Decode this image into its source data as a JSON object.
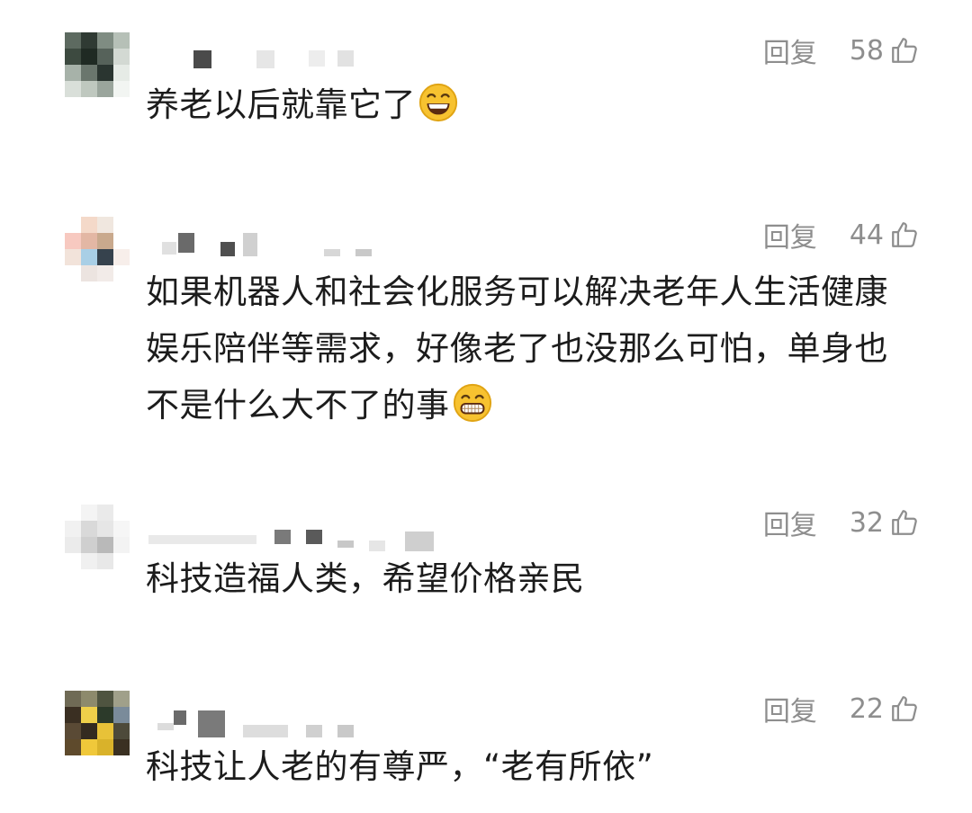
{
  "comments": [
    {
      "reply_label": "回复",
      "likes": "58",
      "text": "养老以后就靠它了",
      "emoji": "grinning-face-icon"
    },
    {
      "reply_label": "回复",
      "likes": "44",
      "text": "如果机器人和社会化服务可以解决老年人生活健康娱乐陪伴等需求，好像老了也没那么可怕，单身也不是什么大不了的事",
      "emoji": "beaming-face-icon"
    },
    {
      "reply_label": "回复",
      "likes": "32",
      "text": "科技造福人类，希望价格亲民"
    },
    {
      "reply_label": "回复",
      "likes": "22",
      "text": "科技让人老的有尊严，“老有所依”"
    }
  ],
  "colors": {
    "meta_gray": "#8e8e8e",
    "text": "#1c1c1c",
    "emoji_yellow": "#f7c230"
  }
}
